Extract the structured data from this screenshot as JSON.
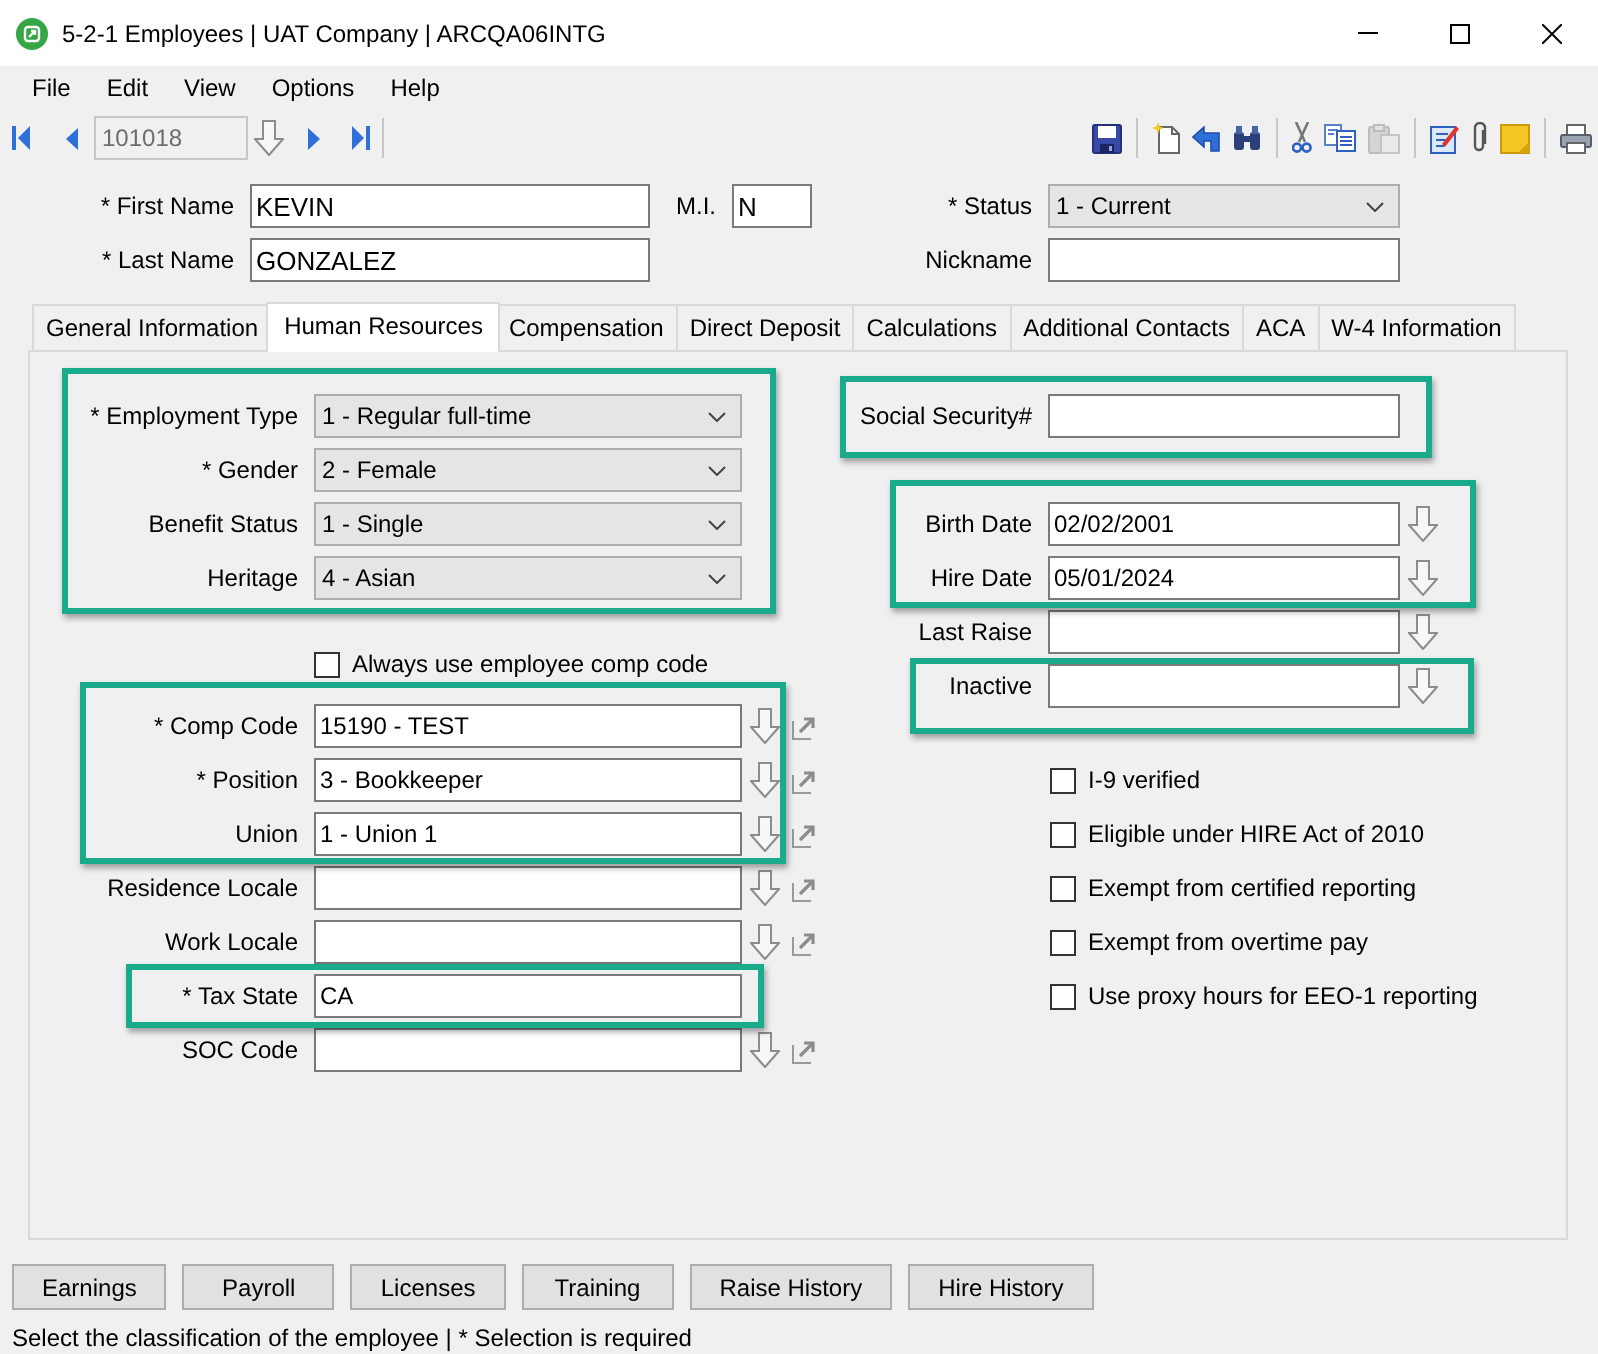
{
  "window": {
    "title": "5-2-1 Employees | UAT Company | ARCQA06INTG"
  },
  "menu": [
    "File",
    "Edit",
    "View",
    "Options",
    "Help"
  ],
  "toolbar": {
    "record": {
      "value": "101018",
      "disabled": true
    },
    "tool_groups": [
      {
        "tools": [
          {
            "kind": "save",
            "disabled": false
          }
        ]
      },
      {
        "tools": [
          {
            "kind": "new",
            "disabled": false
          },
          {
            "kind": "undo",
            "disabled": false
          },
          {
            "kind": "find",
            "disabled": false
          }
        ]
      },
      {
        "tools": [
          {
            "kind": "cut",
            "disabled": false
          },
          {
            "kind": "copy",
            "disabled": false
          },
          {
            "kind": "paste",
            "disabled": true
          }
        ]
      },
      {
        "tools": [
          {
            "kind": "notes",
            "disabled": false
          },
          {
            "kind": "attach",
            "disabled": false
          },
          {
            "kind": "sticky",
            "disabled": false
          }
        ]
      },
      {
        "tools": [
          {
            "kind": "print",
            "disabled": false
          }
        ]
      }
    ]
  },
  "header": {
    "fields": [
      {
        "kind": "text",
        "label": "* First Name",
        "value": "KEVIN"
      },
      {
        "kind": "text",
        "label": "M.I.",
        "value": "N"
      },
      {
        "kind": "select",
        "label": "* Status",
        "value": "1 - Current"
      },
      {
        "kind": "text",
        "label": "* Last Name",
        "value": "GONZALEZ"
      },
      {
        "kind": "text",
        "label": "Nickname"
      }
    ]
  },
  "tabs": [
    {
      "label": "General Information",
      "selected": false
    },
    {
      "label": "Human Resources",
      "selected": true
    },
    {
      "label": "Compensation",
      "selected": false
    },
    {
      "label": "Direct Deposit",
      "selected": false
    },
    {
      "label": "Calculations",
      "selected": false
    },
    {
      "label": "Additional Contacts",
      "selected": false
    },
    {
      "label": "ACA",
      "selected": false
    },
    {
      "label": "W-4 Information",
      "selected": false
    }
  ],
  "hr_panel": {
    "left_groups": [
      {
        "highlighted": true,
        "fields": [
          {
            "kind": "select",
            "label": "* Employment Type",
            "value": "1 - Regular full-time"
          },
          {
            "kind": "select",
            "label": "* Gender",
            "value": "2 - Female"
          },
          {
            "kind": "select",
            "label": "Benefit Status",
            "value": "1 - Single"
          },
          {
            "kind": "select",
            "label": "Heritage",
            "value": "4 - Asian"
          }
        ]
      },
      {
        "highlighted": false,
        "fields": [
          {
            "kind": "checkbox",
            "label": "Always use employee comp code",
            "checked": false
          }
        ]
      },
      {
        "highlighted": true,
        "fields": [
          {
            "kind": "lookup",
            "label": "* Comp Code",
            "value": "15190 - TEST"
          },
          {
            "kind": "lookup",
            "label": "* Position",
            "value": "3 - Bookkeeper"
          },
          {
            "kind": "lookup",
            "label": "Union",
            "value": "1 - Union 1"
          }
        ]
      },
      {
        "highlighted": false,
        "fields": [
          {
            "kind": "lookup",
            "label": "Residence Locale"
          },
          {
            "kind": "lookup",
            "label": "Work Locale"
          }
        ]
      },
      {
        "highlighted": true,
        "fields": [
          {
            "kind": "text",
            "label": "* Tax State",
            "value": "CA"
          }
        ]
      },
      {
        "highlighted": false,
        "fields": [
          {
            "kind": "lookup",
            "label": "SOC Code"
          }
        ]
      }
    ],
    "right_groups": [
      {
        "highlighted": true,
        "fields": [
          {
            "kind": "text",
            "label": "Social Security#"
          }
        ]
      },
      {
        "highlighted": true,
        "fields": [
          {
            "kind": "date",
            "label": "Birth Date",
            "value": "02/02/2001"
          },
          {
            "kind": "date",
            "label": "Hire Date",
            "value": "05/01/2024"
          }
        ]
      },
      {
        "highlighted": false,
        "fields": [
          {
            "kind": "date",
            "label": "Last Raise"
          }
        ]
      },
      {
        "highlighted": true,
        "fields": [
          {
            "kind": "date",
            "label": "Inactive"
          }
        ]
      },
      {
        "highlighted": false,
        "fields": [
          {
            "kind": "checkbox",
            "label": "I-9 verified",
            "checked": false
          },
          {
            "kind": "checkbox",
            "label": "Eligible under HIRE Act of 2010",
            "checked": false
          },
          {
            "kind": "checkbox",
            "label": "Exempt from certified reporting",
            "checked": false
          },
          {
            "kind": "checkbox",
            "label": "Exempt from overtime pay",
            "checked": false
          },
          {
            "kind": "checkbox",
            "label": "Use proxy hours for EEO-1 reporting",
            "checked": false
          }
        ]
      }
    ]
  },
  "buttons": [
    "Earnings",
    "Payroll",
    "Licenses",
    "Training",
    "Raise History",
    "Hire History"
  ],
  "status_bar": "Select the classification of the employee | * Selection is required"
}
